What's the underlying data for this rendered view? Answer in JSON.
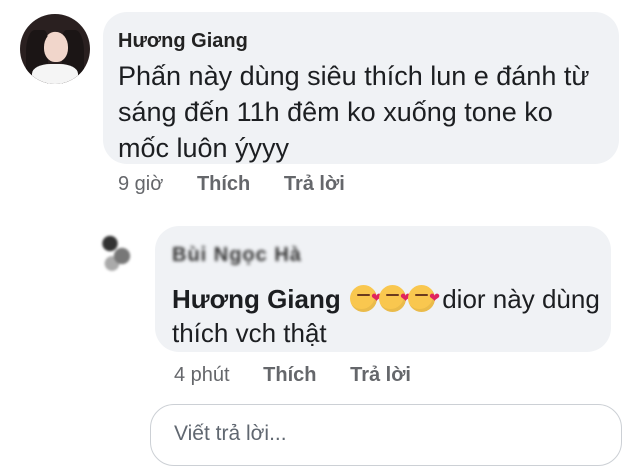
{
  "comment": {
    "author": "Hương Giang",
    "text": "Phấn này dùng siêu thích lun e đánh từ sáng đến 11h đêm ko xuống tone ko mốc luôn ýyyy",
    "time": "9 giờ",
    "like_label": "Thích",
    "reply_label": "Trả lời",
    "avatar_icon": "profile-photo"
  },
  "reply": {
    "author_blurred": "Bùi Ngọc Hà",
    "tag": "Hương Giang",
    "emojis": [
      "face-blowing-kiss-icon",
      "face-blowing-kiss-icon",
      "face-blowing-kiss-icon"
    ],
    "text": "dior này dùng thích vch thật",
    "time": "4 phút",
    "like_label": "Thích",
    "reply_label": "Trả lời"
  },
  "reply_input": {
    "placeholder": "Viết trả lời..."
  },
  "colors": {
    "bubble": "#f0f2f5",
    "meta_text": "#65676b",
    "main_text": "#1c1e21"
  }
}
